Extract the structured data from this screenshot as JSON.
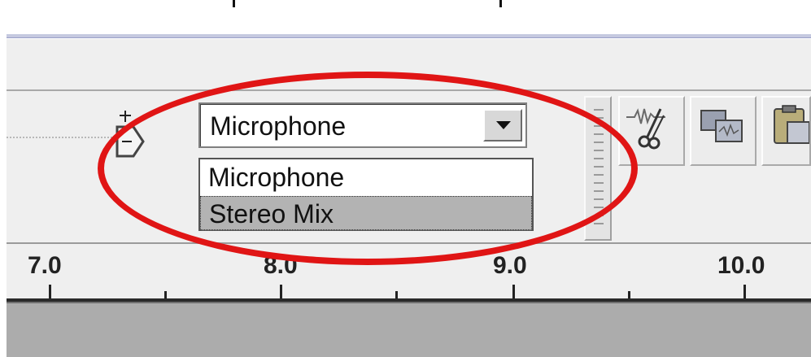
{
  "input_source": {
    "selected": "Microphone",
    "options": [
      "Microphone",
      "Stereo Mix"
    ],
    "highlighted_option": "Stereo Mix"
  },
  "timeline": {
    "labels": [
      "7.0",
      "8.0",
      "9.0",
      "10.0"
    ]
  },
  "icons": {
    "volume_thumb": "input-volume-slider-thumb",
    "trim_tool": "trim-scissors-icon",
    "copy_tool": "copy-icon",
    "paste_tool": "paste-icon",
    "toolbar_grip": "toolbar-grip-handle"
  },
  "colors": {
    "annotation_ellipse": "#e01515",
    "highlighted_option_bg": "#b3b3b3",
    "toolbar_bg": "#efefef",
    "track_bg": "#acacac"
  }
}
